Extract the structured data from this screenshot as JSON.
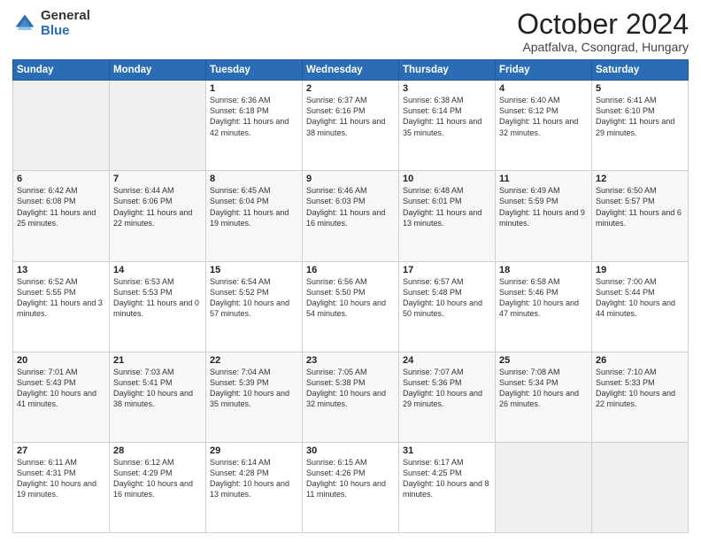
{
  "logo": {
    "general": "General",
    "blue": "Blue"
  },
  "header": {
    "month": "October 2024",
    "location": "Apatfalva, Csongrad, Hungary"
  },
  "days_of_week": [
    "Sunday",
    "Monday",
    "Tuesday",
    "Wednesday",
    "Thursday",
    "Friday",
    "Saturday"
  ],
  "weeks": [
    [
      {
        "day": "",
        "sunrise": "",
        "sunset": "",
        "daylight": "",
        "empty": true
      },
      {
        "day": "",
        "sunrise": "",
        "sunset": "",
        "daylight": "",
        "empty": true
      },
      {
        "day": "1",
        "sunrise": "Sunrise: 6:36 AM",
        "sunset": "Sunset: 6:18 PM",
        "daylight": "Daylight: 11 hours and 42 minutes."
      },
      {
        "day": "2",
        "sunrise": "Sunrise: 6:37 AM",
        "sunset": "Sunset: 6:16 PM",
        "daylight": "Daylight: 11 hours and 38 minutes."
      },
      {
        "day": "3",
        "sunrise": "Sunrise: 6:38 AM",
        "sunset": "Sunset: 6:14 PM",
        "daylight": "Daylight: 11 hours and 35 minutes."
      },
      {
        "day": "4",
        "sunrise": "Sunrise: 6:40 AM",
        "sunset": "Sunset: 6:12 PM",
        "daylight": "Daylight: 11 hours and 32 minutes."
      },
      {
        "day": "5",
        "sunrise": "Sunrise: 6:41 AM",
        "sunset": "Sunset: 6:10 PM",
        "daylight": "Daylight: 11 hours and 29 minutes."
      }
    ],
    [
      {
        "day": "6",
        "sunrise": "Sunrise: 6:42 AM",
        "sunset": "Sunset: 6:08 PM",
        "daylight": "Daylight: 11 hours and 25 minutes."
      },
      {
        "day": "7",
        "sunrise": "Sunrise: 6:44 AM",
        "sunset": "Sunset: 6:06 PM",
        "daylight": "Daylight: 11 hours and 22 minutes."
      },
      {
        "day": "8",
        "sunrise": "Sunrise: 6:45 AM",
        "sunset": "Sunset: 6:04 PM",
        "daylight": "Daylight: 11 hours and 19 minutes."
      },
      {
        "day": "9",
        "sunrise": "Sunrise: 6:46 AM",
        "sunset": "Sunset: 6:03 PM",
        "daylight": "Daylight: 11 hours and 16 minutes."
      },
      {
        "day": "10",
        "sunrise": "Sunrise: 6:48 AM",
        "sunset": "Sunset: 6:01 PM",
        "daylight": "Daylight: 11 hours and 13 minutes."
      },
      {
        "day": "11",
        "sunrise": "Sunrise: 6:49 AM",
        "sunset": "Sunset: 5:59 PM",
        "daylight": "Daylight: 11 hours and 9 minutes."
      },
      {
        "day": "12",
        "sunrise": "Sunrise: 6:50 AM",
        "sunset": "Sunset: 5:57 PM",
        "daylight": "Daylight: 11 hours and 6 minutes."
      }
    ],
    [
      {
        "day": "13",
        "sunrise": "Sunrise: 6:52 AM",
        "sunset": "Sunset: 5:55 PM",
        "daylight": "Daylight: 11 hours and 3 minutes."
      },
      {
        "day": "14",
        "sunrise": "Sunrise: 6:53 AM",
        "sunset": "Sunset: 5:53 PM",
        "daylight": "Daylight: 11 hours and 0 minutes."
      },
      {
        "day": "15",
        "sunrise": "Sunrise: 6:54 AM",
        "sunset": "Sunset: 5:52 PM",
        "daylight": "Daylight: 10 hours and 57 minutes."
      },
      {
        "day": "16",
        "sunrise": "Sunrise: 6:56 AM",
        "sunset": "Sunset: 5:50 PM",
        "daylight": "Daylight: 10 hours and 54 minutes."
      },
      {
        "day": "17",
        "sunrise": "Sunrise: 6:57 AM",
        "sunset": "Sunset: 5:48 PM",
        "daylight": "Daylight: 10 hours and 50 minutes."
      },
      {
        "day": "18",
        "sunrise": "Sunrise: 6:58 AM",
        "sunset": "Sunset: 5:46 PM",
        "daylight": "Daylight: 10 hours and 47 minutes."
      },
      {
        "day": "19",
        "sunrise": "Sunrise: 7:00 AM",
        "sunset": "Sunset: 5:44 PM",
        "daylight": "Daylight: 10 hours and 44 minutes."
      }
    ],
    [
      {
        "day": "20",
        "sunrise": "Sunrise: 7:01 AM",
        "sunset": "Sunset: 5:43 PM",
        "daylight": "Daylight: 10 hours and 41 minutes."
      },
      {
        "day": "21",
        "sunrise": "Sunrise: 7:03 AM",
        "sunset": "Sunset: 5:41 PM",
        "daylight": "Daylight: 10 hours and 38 minutes."
      },
      {
        "day": "22",
        "sunrise": "Sunrise: 7:04 AM",
        "sunset": "Sunset: 5:39 PM",
        "daylight": "Daylight: 10 hours and 35 minutes."
      },
      {
        "day": "23",
        "sunrise": "Sunrise: 7:05 AM",
        "sunset": "Sunset: 5:38 PM",
        "daylight": "Daylight: 10 hours and 32 minutes."
      },
      {
        "day": "24",
        "sunrise": "Sunrise: 7:07 AM",
        "sunset": "Sunset: 5:36 PM",
        "daylight": "Daylight: 10 hours and 29 minutes."
      },
      {
        "day": "25",
        "sunrise": "Sunrise: 7:08 AM",
        "sunset": "Sunset: 5:34 PM",
        "daylight": "Daylight: 10 hours and 26 minutes."
      },
      {
        "day": "26",
        "sunrise": "Sunrise: 7:10 AM",
        "sunset": "Sunset: 5:33 PM",
        "daylight": "Daylight: 10 hours and 22 minutes."
      }
    ],
    [
      {
        "day": "27",
        "sunrise": "Sunrise: 6:11 AM",
        "sunset": "Sunset: 4:31 PM",
        "daylight": "Daylight: 10 hours and 19 minutes."
      },
      {
        "day": "28",
        "sunrise": "Sunrise: 6:12 AM",
        "sunset": "Sunset: 4:29 PM",
        "daylight": "Daylight: 10 hours and 16 minutes."
      },
      {
        "day": "29",
        "sunrise": "Sunrise: 6:14 AM",
        "sunset": "Sunset: 4:28 PM",
        "daylight": "Daylight: 10 hours and 13 minutes."
      },
      {
        "day": "30",
        "sunrise": "Sunrise: 6:15 AM",
        "sunset": "Sunset: 4:26 PM",
        "daylight": "Daylight: 10 hours and 11 minutes."
      },
      {
        "day": "31",
        "sunrise": "Sunrise: 6:17 AM",
        "sunset": "Sunset: 4:25 PM",
        "daylight": "Daylight: 10 hours and 8 minutes."
      },
      {
        "day": "",
        "sunrise": "",
        "sunset": "",
        "daylight": "",
        "empty": true
      },
      {
        "day": "",
        "sunrise": "",
        "sunset": "",
        "daylight": "",
        "empty": true
      }
    ]
  ]
}
